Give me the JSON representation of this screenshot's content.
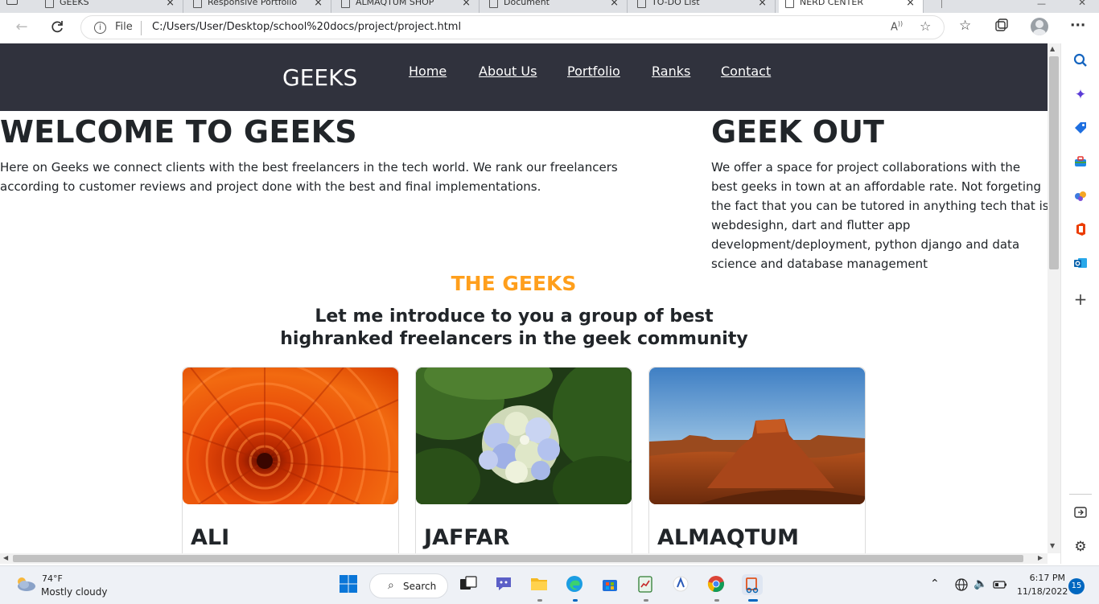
{
  "browser": {
    "tabs": [
      {
        "title": "GEEKS",
        "active": false
      },
      {
        "title": "Responsive Portfolio",
        "active": false
      },
      {
        "title": "ALMAQTUM SHOP",
        "active": false
      },
      {
        "title": "Document",
        "active": false
      },
      {
        "title": "TO-DO List",
        "active": false
      },
      {
        "title": "NERD CENTER",
        "active": true
      }
    ],
    "close_glyph": "×",
    "address": {
      "scheme_label": "File",
      "url": "C:/Users/User/Desktop/school%20docs/project/project.html"
    }
  },
  "site": {
    "brand": "GEEKS",
    "nav": [
      "Home",
      "About Us",
      "Portfolio",
      "Ranks",
      "Contact"
    ],
    "welcome": {
      "title": "WELCOME TO GEEKS",
      "text": "Here on Geeks we connect clients with the best freelancers in the tech world. We rank our freelancers according to customer reviews and project done with the best and final implementations."
    },
    "geek_out": {
      "title": "GEEK OUT",
      "text": "We offer a space for project collaborations with the best geeks in town at an affordable rate. Not forgeting the fact that you can be tutored in anything tech that is webdesighn, dart and flutter app development/deployment, python django and data science and database management"
    },
    "section": {
      "heading": "THE GEEKS",
      "subheading": "Let me introduce to you a group of best highranked freelancers in the geek community",
      "heading_color": "#ff9f1c"
    },
    "cards": [
      {
        "name": "ALI",
        "image": "orange-chrysanthemum"
      },
      {
        "name": "JAFFAR",
        "image": "blue-hydrangea"
      },
      {
        "name": "ALMAQTUM",
        "image": "desert-butte"
      }
    ],
    "nav_bg": "#30323d"
  },
  "taskbar": {
    "weather": {
      "temp": "74°F",
      "desc": "Mostly cloudy"
    },
    "search_label": "Search",
    "clock": {
      "time": "6:17 PM",
      "date": "11/18/2022"
    },
    "notifications": "15"
  }
}
